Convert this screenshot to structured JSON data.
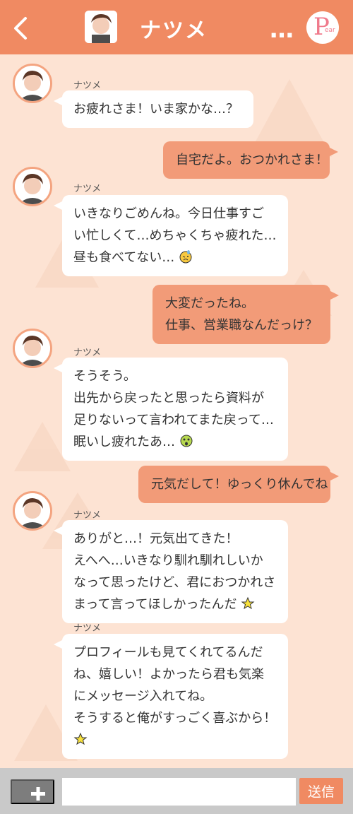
{
  "header": {
    "back_icon": "chevron-left-icon",
    "title": "ナツメ",
    "menu_dots": "…",
    "logo_letter": "P",
    "logo_small": "ear"
  },
  "colors": {
    "header": "#f08a62",
    "background": "#fde3d3",
    "outgoing_bubble": "#f29b78",
    "incoming_bubble": "#ffffff"
  },
  "messages": [
    {
      "sender": "ナツメ",
      "lines": [
        "お疲れさま！いま家かな…？"
      ]
    },
    {
      "lines": [
        "自宅だよ。おつかれさま！"
      ]
    },
    {
      "sender": "ナツメ",
      "lines": [
        "いきなりごめんね。今日仕事すご",
        "い忙しくて…めちゃくちゃ疲れた…",
        "昼も食べてない…"
      ],
      "emoji": "sweat-face-icon"
    },
    {
      "lines": [
        "大変だったね。",
        "仕事、営業職なんだっけ？"
      ]
    },
    {
      "sender": "ナツメ",
      "lines": [
        "そうそう。",
        "出先から戻ったと思ったら資料が",
        "足りないって言われてまた戻って…",
        "眠いし疲れたあ…"
      ],
      "emoji": "dizzy-face-icon"
    },
    {
      "lines": [
        "元気だして！ゆっくり休んでね"
      ]
    },
    {
      "sender": "ナツメ",
      "lines": [
        "ありがと…！元気出てきた！",
        "えへへ…いきなり馴れ馴れしいか",
        "なって思ったけど、君におつかれさ",
        "まって言ってほしかったんだ"
      ],
      "emoji": "sparkle-star-icon"
    },
    {
      "sender": "ナツメ",
      "lines": [
        "プロフィールも見てくれてるんだ",
        "ね、嬉しい！よかったら君も気楽",
        "にメッセージ入れてね。",
        "そうすると俺がすっごく喜ぶから！"
      ],
      "emoji": "sparkle-star-icon"
    }
  ],
  "composer": {
    "plus_icon": "plus-icon",
    "input_value": "",
    "send_label": "送信"
  }
}
